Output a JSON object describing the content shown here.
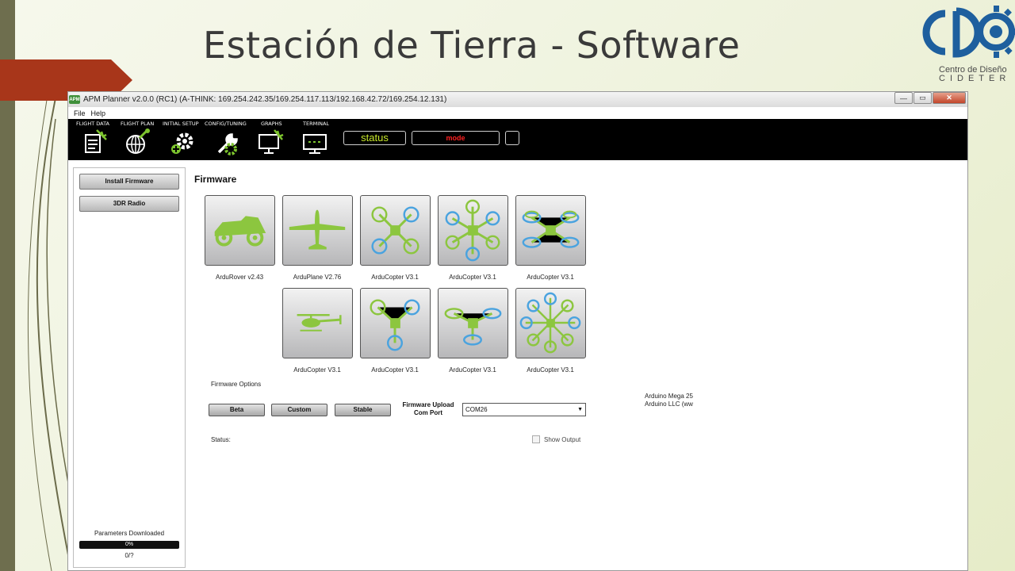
{
  "slide": {
    "title": "Estación de Tierra - Software",
    "logo": {
      "text": "CDO",
      "subtitle_line1": "Centro de Diseño",
      "subtitle_line2": "CIDETER"
    },
    "colors": {
      "accent_red": "#a8361a",
      "strip": "#6e6e4e",
      "logo_blue": "#1e5f9e"
    }
  },
  "window": {
    "icon_text": "APM",
    "title": "APM Planner v2.0.0 (RC1) (A-THINK: 169.254.242.35/169.254.117.113/192.168.42.72/169.254.12.131)",
    "controls": {
      "minimize": "—",
      "maximize": "▭",
      "close": "✕"
    }
  },
  "menu": [
    "File",
    "Help"
  ],
  "toolbar": {
    "items": [
      {
        "label": "FLIGHT DATA",
        "icon": "flight-data-icon"
      },
      {
        "label": "FLIGHT PLAN",
        "icon": "flight-plan-icon"
      },
      {
        "label": "INITIAL SETUP",
        "icon": "initial-setup-icon"
      },
      {
        "label": "CONFIG/TUNING",
        "icon": "config-tuning-icon"
      },
      {
        "label": "GRAPHS",
        "icon": "graphs-icon"
      },
      {
        "label": "TERMINAL",
        "icon": "terminal-icon"
      }
    ],
    "status": "status",
    "mode": "mode",
    "colors": {
      "status": "#c8e82a",
      "mode": "#ff2020",
      "icon": "#ffffff",
      "icon_accent": "#7dc42e"
    }
  },
  "sidebar": {
    "buttons": [
      "Install Firmware",
      "3DR Radio"
    ],
    "parameters_label": "Parameters Downloaded",
    "progress_text": "0%",
    "progress_value": 0,
    "count": "0/?"
  },
  "firmware": {
    "title": "Firmware",
    "tiles": [
      {
        "label": "ArduRover v2.43",
        "icon": "rover-icon"
      },
      {
        "label": "ArduPlane V2.76",
        "icon": "plane-icon"
      },
      {
        "label": "ArduCopter V3.1",
        "icon": "quad-x-icon"
      },
      {
        "label": "ArduCopter V3.1",
        "icon": "hexa-icon"
      },
      {
        "label": "ArduCopter V3.1",
        "icon": "y6-icon"
      },
      {
        "label": "ArduCopter V3.1",
        "icon": "heli-icon"
      },
      {
        "label": "ArduCopter V3.1",
        "icon": "tri-icon"
      },
      {
        "label": "ArduCopter V3.1",
        "icon": "y3-icon"
      },
      {
        "label": "ArduCopter V3.1",
        "icon": "octa-icon"
      }
    ],
    "options_label": "Firmware Options",
    "option_buttons": [
      "Beta",
      "Custom",
      "Stable"
    ],
    "upload_label": "Firmware Upload Com Port",
    "com_port": "COM26",
    "arduino_line1": "Arduino Mega 25",
    "arduino_line2": "Arduino LLC (ww",
    "status_label": "Status:",
    "show_output_label": "Show Output",
    "colors": {
      "frame": "#8cc63f",
      "prop_blue": "#4aa3df"
    }
  }
}
